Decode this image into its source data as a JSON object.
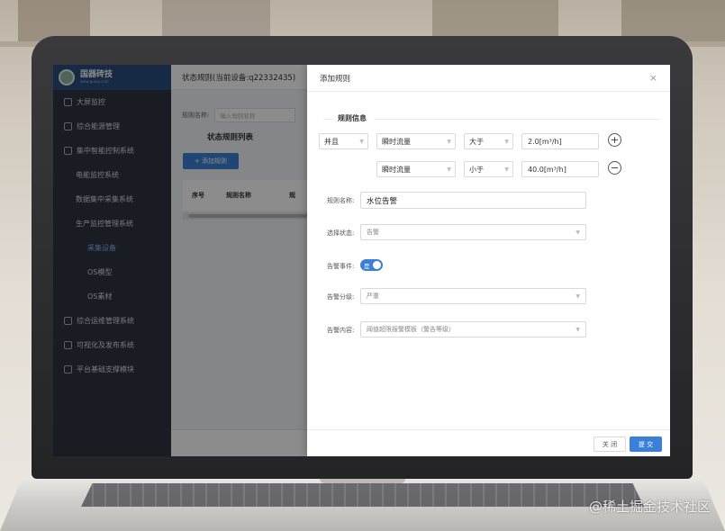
{
  "sidebar": {
    "brand": {
      "name": "国器砖技",
      "sub": "www.guoqi.com"
    },
    "items": [
      {
        "label": "大屏监控"
      },
      {
        "label": "综合能源管理"
      },
      {
        "label": "集中智能控制系统"
      },
      {
        "label": "电能监控系统"
      },
      {
        "label": "数据集中采集系统"
      },
      {
        "label": "生产监控管理系统"
      },
      {
        "label": "采集设备"
      },
      {
        "label": "OS模型"
      },
      {
        "label": "OS素材"
      },
      {
        "label": "综合运维管理系统"
      },
      {
        "label": "可视化及发布系统"
      },
      {
        "label": "平台基础支撑模块"
      }
    ]
  },
  "main": {
    "header": "状态规则(当前设备:q22332435)",
    "rule_name_label": "规则名称:",
    "rule_name_placeholder": "输入规则名称",
    "list_title": "状态规则列表",
    "add_button": "+ 添加规则",
    "columns": [
      "序号",
      "规则名称",
      "规"
    ]
  },
  "dialog": {
    "title": "添加规则",
    "close_icon": "×",
    "section_title": "规则信息",
    "condition_row1": {
      "logic": "并且",
      "metric": "瞬时流量",
      "operator": "大于",
      "value": "2.0[m³/h]",
      "action_icon": "+"
    },
    "condition_row2": {
      "metric": "瞬时流量",
      "operator": "小于",
      "value": "40.0[m³/h]",
      "action_icon": "−"
    },
    "fields": {
      "rule_name_label": "规则名称:",
      "rule_name_value": "水位告警",
      "status_label": "选择状态:",
      "status_value": "告警",
      "event_label": "告警事件:",
      "event_toggle": "是",
      "level_label": "告警分级:",
      "level_value": "严重",
      "content_label": "告警内容:",
      "content_value": "阈值超限报警模板（警告等级）"
    },
    "footer": {
      "close": "关 闭",
      "submit": "提 交"
    }
  },
  "watermark": "@稀土掘金技术社区"
}
